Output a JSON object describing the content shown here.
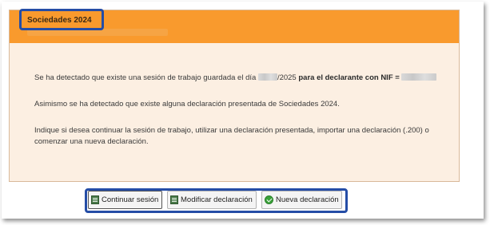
{
  "dialog": {
    "title": "Sociedades 2024",
    "session_message": {
      "prefix": "Se ha detectado que existe una sesión de trabajo guardada el día",
      "date_suffix": "/2025",
      "bold_text": "para el declarante con NIF ="
    },
    "presented_message": "Asimismo se ha detectado que existe alguna declaración presentada de Sociedades 2024.",
    "instruction_message": "Indique si desea continuar la sesión de trabajo, utilizar una declaración presentada, importar una declaración (.200) o comenzar una nueva declaración."
  },
  "buttons": {
    "continue": {
      "label": "Continuar sesión",
      "icon": "document-icon"
    },
    "modify": {
      "label": "Modificar declaración",
      "icon": "document-icon"
    },
    "new": {
      "label": "Nueva declaración",
      "icon": "check-icon"
    }
  },
  "colors": {
    "header": "#f99a2d",
    "panel_background": "#fcefe2",
    "highlight_border": "#254da6"
  }
}
